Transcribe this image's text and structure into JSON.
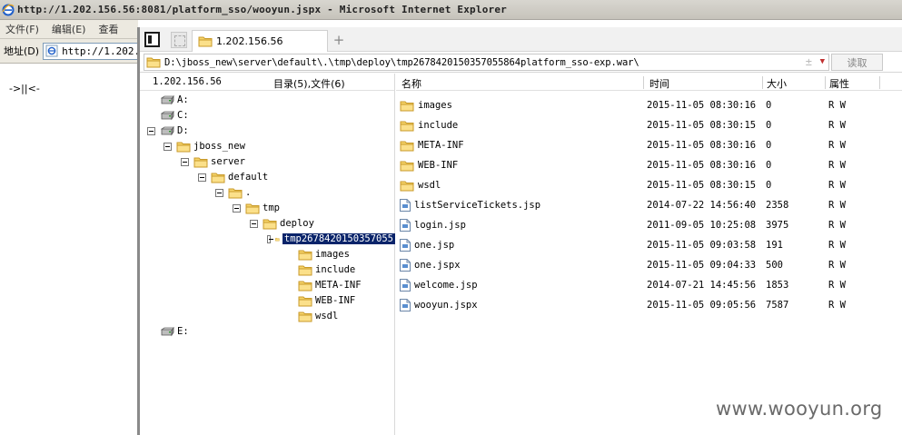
{
  "ie": {
    "title": "http://1.202.156.56:8081/platform_sso/wooyun.jspx - Microsoft Internet Explorer",
    "menu": [
      "文件(F)",
      "编辑(E)",
      "查看"
    ],
    "address_label": "地址(D)",
    "address_value": "http://1.202.",
    "page_text": "->||<-"
  },
  "fm": {
    "tab_label": "1.202.156.56",
    "tab_add": "+",
    "path": "D:\\jboss_new\\server\\default\\.\\tmp\\deploy\\tmp2678420150357055864platform_sso-exp.war\\",
    "path_extra": "±",
    "read_button": "读取",
    "tree": {
      "host": "1.202.156.56",
      "count": "目录(5),文件(6)",
      "nodes": [
        {
          "label": "A:"
        },
        {
          "label": "C:"
        },
        {
          "label": "D:"
        },
        {
          "label": "jboss_new"
        },
        {
          "label": "server"
        },
        {
          "label": "default"
        },
        {
          "label": "."
        },
        {
          "label": "tmp"
        },
        {
          "label": "deploy"
        },
        {
          "label": "tmp2678420150357055"
        },
        {
          "label": "images"
        },
        {
          "label": "include"
        },
        {
          "label": "META-INF"
        },
        {
          "label": "WEB-INF"
        },
        {
          "label": "wsdl"
        },
        {
          "label": "E:"
        }
      ]
    },
    "list": {
      "headers": {
        "name": "名称",
        "time": "时间",
        "size": "大小",
        "attr": "属性"
      },
      "rows": [
        {
          "name": "images",
          "time": "2015-11-05 08:30:16",
          "size": "0",
          "attr": "R W",
          "kind": "folder"
        },
        {
          "name": "include",
          "time": "2015-11-05 08:30:15",
          "size": "0",
          "attr": "R W",
          "kind": "folder"
        },
        {
          "name": "META-INF",
          "time": "2015-11-05 08:30:16",
          "size": "0",
          "attr": "R W",
          "kind": "folder"
        },
        {
          "name": "WEB-INF",
          "time": "2015-11-05 08:30:16",
          "size": "0",
          "attr": "R W",
          "kind": "folder"
        },
        {
          "name": "wsdl",
          "time": "2015-11-05 08:30:15",
          "size": "0",
          "attr": "R W",
          "kind": "folder"
        },
        {
          "name": "listServiceTickets.jsp",
          "time": "2014-07-22 14:56:40",
          "size": "2358",
          "attr": "R W",
          "kind": "file"
        },
        {
          "name": "login.jsp",
          "time": "2011-09-05 10:25:08",
          "size": "3975",
          "attr": "R W",
          "kind": "file"
        },
        {
          "name": "one.jsp",
          "time": "2015-11-05 09:03:58",
          "size": "191",
          "attr": "R W",
          "kind": "file"
        },
        {
          "name": "one.jspx",
          "time": "2015-11-05 09:04:33",
          "size": "500",
          "attr": "R W",
          "kind": "file"
        },
        {
          "name": "welcome.jsp",
          "time": "2014-07-21 14:45:56",
          "size": "1853",
          "attr": "R W",
          "kind": "file"
        },
        {
          "name": "wooyun.jspx",
          "time": "2015-11-05 09:05:56",
          "size": "7587",
          "attr": "R W",
          "kind": "file"
        }
      ]
    }
  },
  "watermark": "www.wooyun.org",
  "colors": {
    "selection": "#0a246a",
    "folder": "#f3c85a",
    "folder_edge": "#c89a2a"
  }
}
